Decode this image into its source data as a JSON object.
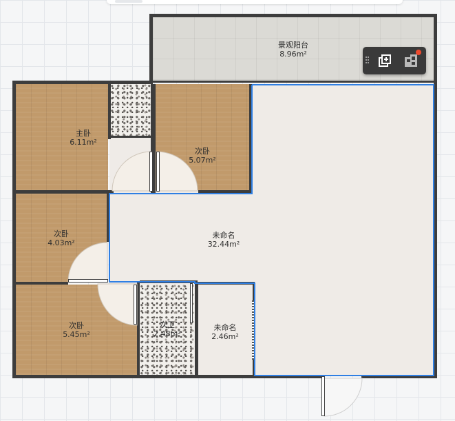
{
  "rooms": {
    "balcony": {
      "name": "景观阳台",
      "area": "8.96m²"
    },
    "master": {
      "name": "主卧",
      "area": "6.11m²"
    },
    "second1": {
      "name": "次卧",
      "area": "5.07m²"
    },
    "unnamed1": {
      "name": "未命名",
      "area": "32.44m²"
    },
    "second2": {
      "name": "次卧",
      "area": "4.03m²"
    },
    "second3": {
      "name": "次卧",
      "area": "5.45m²"
    },
    "bath": {
      "name": "次卫",
      "area": "2.48m²"
    },
    "unnamed2": {
      "name": "未命名",
      "area": "2.46m²"
    }
  },
  "toolbar": {
    "buttons": [
      {
        "icon": "add-layer-icon",
        "tooltip": ""
      },
      {
        "icon": "floorplan-icon",
        "tooltip": "",
        "badge": true
      }
    ]
  },
  "colors": {
    "selection": "#2f7fe3",
    "wall": "#3d3d3d",
    "wood": "#c19a6b",
    "living": "#efebe7",
    "balcony": "#dbdad5",
    "badge": "#f04a2e"
  }
}
